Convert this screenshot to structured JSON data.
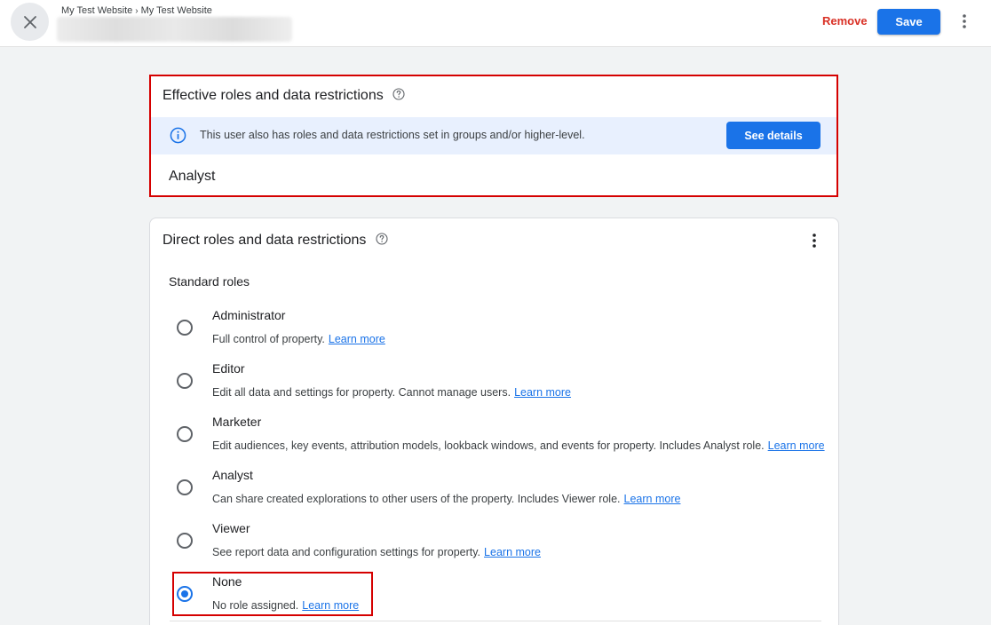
{
  "header": {
    "breadcrumb": [
      "My Test Website",
      "My Test Website"
    ],
    "remove_label": "Remove",
    "save_label": "Save"
  },
  "effective": {
    "title": "Effective roles and data restrictions",
    "banner_text": "This user also has roles and data restrictions set in groups and/or higher-level.",
    "see_details_label": "See details",
    "role": "Analyst"
  },
  "direct": {
    "title": "Direct roles and data restrictions",
    "section_label": "Standard roles",
    "options": [
      {
        "name": "Administrator",
        "desc": "Full control of property.",
        "link": "Learn more",
        "checked": false
      },
      {
        "name": "Editor",
        "desc": "Edit all data and settings for property. Cannot manage users.",
        "link": "Learn more",
        "checked": false
      },
      {
        "name": "Marketer",
        "desc": "Edit audiences, key events, attribution models, lookback windows, and events for property. Includes Analyst role.",
        "link": "Learn more",
        "checked": false
      },
      {
        "name": "Analyst",
        "desc": "Can share created explorations to other users of the property. Includes Viewer role.",
        "link": "Learn more",
        "checked": false
      },
      {
        "name": "Viewer",
        "desc": "See report data and configuration settings for property.",
        "link": "Learn more",
        "checked": false
      },
      {
        "name": "None",
        "desc": "No role assigned.",
        "link": "Learn more",
        "checked": true
      }
    ]
  },
  "colors": {
    "accent": "#1a73e8",
    "danger": "#d93025",
    "highlight_border": "#d50000",
    "banner_bg": "#e8f0fe"
  },
  "icons": {
    "close": "close-icon",
    "more": "more-vert-icon",
    "help": "help-circle-icon",
    "info": "info-icon"
  }
}
